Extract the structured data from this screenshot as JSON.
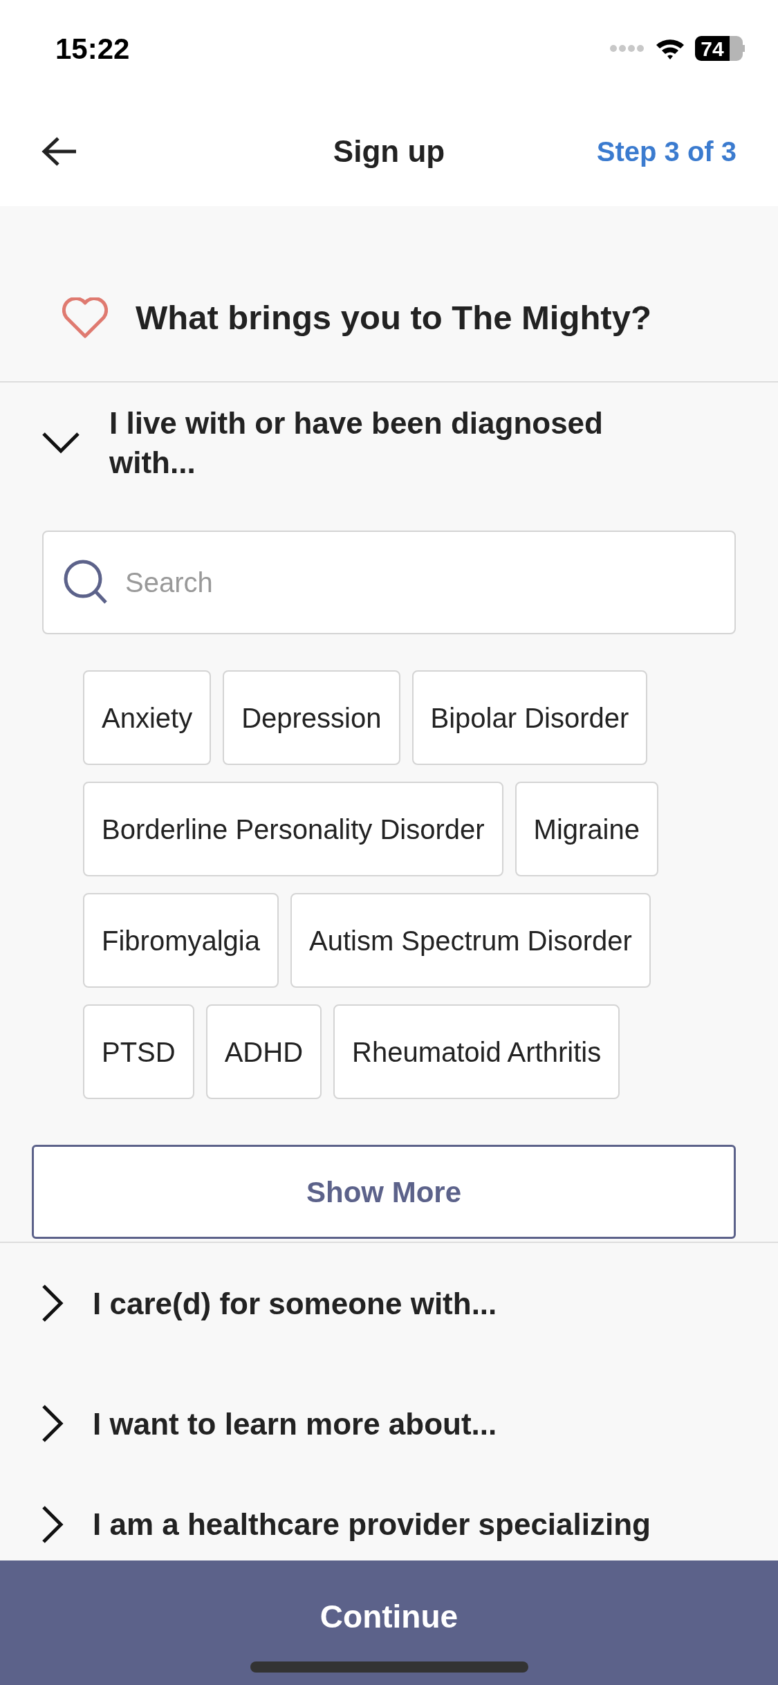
{
  "status_bar": {
    "time": "15:22",
    "battery": "74"
  },
  "header": {
    "title": "Sign up",
    "step": "Step 3 of 3"
  },
  "question": "What brings you to The Mighty?",
  "sections": [
    {
      "label": "I live with or have been diagnosed with...",
      "expanded": true,
      "search": {
        "placeholder": "Search"
      },
      "chips": [
        "Anxiety",
        "Depression",
        "Bipolar Disorder",
        "Borderline Personality Disorder",
        "Migraine",
        "Fibromyalgia",
        "Autism Spectrum Disorder",
        "PTSD",
        "ADHD",
        "Rheumatoid Arthritis"
      ],
      "show_more": "Show More"
    },
    {
      "label": "I care(d) for someone with...",
      "expanded": false
    },
    {
      "label": "I want to learn more about...",
      "expanded": false
    },
    {
      "label": "I am a healthcare provider specializing",
      "expanded": false
    }
  ],
  "continue_button": "Continue"
}
